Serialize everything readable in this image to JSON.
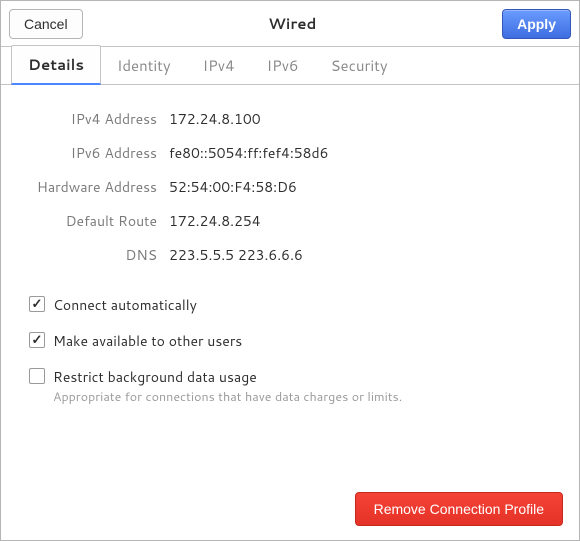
{
  "titlebar": {
    "cancel_label": "Cancel",
    "title": "Wired",
    "apply_label": "Apply"
  },
  "tabs": {
    "details": "Details",
    "identity": "Identity",
    "ipv4": "IPv4",
    "ipv6": "IPv6",
    "security": "Security"
  },
  "details": {
    "ipv4_label": "IPv4 Address",
    "ipv4_value": "172.24.8.100",
    "ipv6_label": "IPv6 Address",
    "ipv6_value": "fe80::5054:ff:fef4:58d6",
    "hw_label": "Hardware Address",
    "hw_value": "52:54:00:F4:58:D6",
    "route_label": "Default Route",
    "route_value": "172.24.8.254",
    "dns_label": "DNS",
    "dns_value": "223.5.5.5 223.6.6.6"
  },
  "options": {
    "connect_auto": "Connect automatically",
    "available_others": "Make available to other users",
    "restrict_bg": "Restrict background data usage",
    "restrict_bg_sub": "Appropriate for connections that have data charges or limits."
  },
  "footer": {
    "remove_label": "Remove Connection Profile"
  }
}
